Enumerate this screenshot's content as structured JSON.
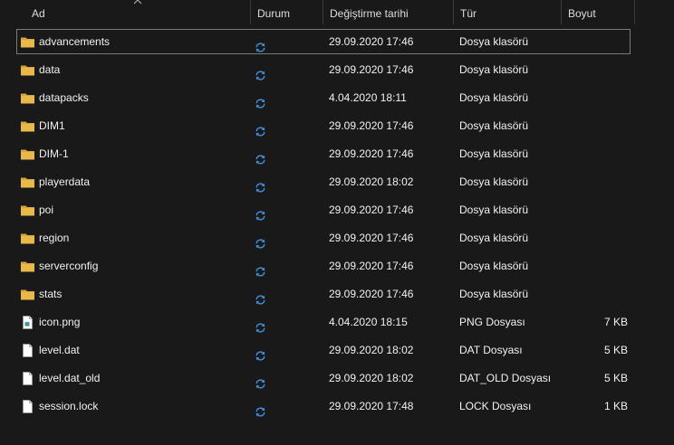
{
  "columns": {
    "name": "Ad",
    "status": "Durum",
    "modified": "Değiştirme tarihi",
    "type": "Tür",
    "size": "Boyut"
  },
  "files": [
    {
      "name": "advancements",
      "icon": "folder-icon",
      "status": "sync-icon",
      "modified": "29.09.2020 17:46",
      "type": "Dosya klasörü",
      "size": "",
      "selected": true
    },
    {
      "name": "data",
      "icon": "folder-icon",
      "status": "sync-icon",
      "modified": "29.09.2020 17:46",
      "type": "Dosya klasörü",
      "size": ""
    },
    {
      "name": "datapacks",
      "icon": "folder-icon",
      "status": "sync-icon",
      "modified": "4.04.2020 18:11",
      "type": "Dosya klasörü",
      "size": ""
    },
    {
      "name": "DIM1",
      "icon": "folder-icon",
      "status": "sync-icon",
      "modified": "29.09.2020 17:46",
      "type": "Dosya klasörü",
      "size": ""
    },
    {
      "name": "DIM-1",
      "icon": "folder-icon",
      "status": "sync-icon",
      "modified": "29.09.2020 17:46",
      "type": "Dosya klasörü",
      "size": ""
    },
    {
      "name": "playerdata",
      "icon": "folder-icon",
      "status": "sync-icon",
      "modified": "29.09.2020 18:02",
      "type": "Dosya klasörü",
      "size": ""
    },
    {
      "name": "poi",
      "icon": "folder-icon",
      "status": "sync-icon",
      "modified": "29.09.2020 17:46",
      "type": "Dosya klasörü",
      "size": ""
    },
    {
      "name": "region",
      "icon": "folder-icon",
      "status": "sync-icon",
      "modified": "29.09.2020 17:46",
      "type": "Dosya klasörü",
      "size": ""
    },
    {
      "name": "serverconfig",
      "icon": "folder-icon",
      "status": "sync-icon",
      "modified": "29.09.2020 17:46",
      "type": "Dosya klasörü",
      "size": ""
    },
    {
      "name": "stats",
      "icon": "folder-icon",
      "status": "sync-icon",
      "modified": "29.09.2020 17:46",
      "type": "Dosya klasörü",
      "size": ""
    },
    {
      "name": "icon.png",
      "icon": "image-file-icon",
      "status": "sync-icon",
      "modified": "4.04.2020 18:15",
      "type": "PNG Dosyası",
      "size": "7 KB"
    },
    {
      "name": "level.dat",
      "icon": "file-icon",
      "status": "sync-icon",
      "modified": "29.09.2020 18:02",
      "type": "DAT Dosyası",
      "size": "5 KB"
    },
    {
      "name": "level.dat_old",
      "icon": "file-icon",
      "status": "sync-icon",
      "modified": "29.09.2020 18:02",
      "type": "DAT_OLD Dosyası",
      "size": "5 KB"
    },
    {
      "name": "session.lock",
      "icon": "file-icon",
      "status": "sync-icon",
      "modified": "29.09.2020 17:48",
      "type": "LOCK Dosyası",
      "size": "1 KB"
    }
  ],
  "colors": {
    "background": "#191919",
    "folder": "#e8b84a",
    "sync": "#3f8fdc",
    "selection_border": "#7a7a7a"
  }
}
